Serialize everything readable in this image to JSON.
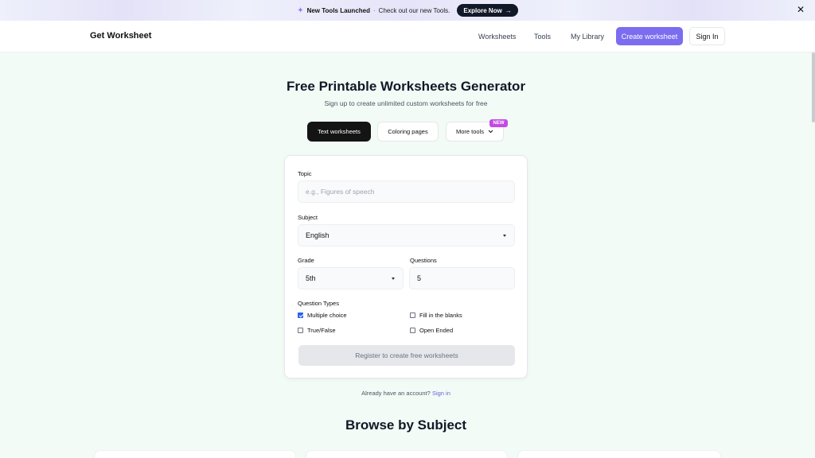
{
  "announcement": {
    "title": "New Tools Launched",
    "separator": "·",
    "message": "Check out our new Tools.",
    "cta": "Explore Now",
    "cta_arrow": "→",
    "close": "✕",
    "icon": "sparkle-icon"
  },
  "nav": {
    "brand": "Get Worksheet",
    "links": [
      "Worksheets",
      "Tools",
      "My Library"
    ],
    "create": "Create worksheet",
    "signin": "Sign In"
  },
  "hero": {
    "title": "Free Printable Worksheets Generator",
    "subtitle": "Sign up to create unlimited custom worksheets for free"
  },
  "tabs": {
    "text": "Text worksheets",
    "coloring": "Coloring pages",
    "more": "More tools",
    "badge": "NEW"
  },
  "form": {
    "topic_label": "Topic",
    "topic_placeholder": "e.g., Figures of speech",
    "subject_label": "Subject",
    "subject_value": "English",
    "grade_label": "Grade",
    "grade_value": "5th",
    "questions_label": "Questions",
    "questions_value": "5",
    "types_label": "Question Types",
    "types": [
      {
        "label": "Multiple choice",
        "checked": true
      },
      {
        "label": "Fill in the blanks",
        "checked": false
      },
      {
        "label": "True/False",
        "checked": false
      },
      {
        "label": "Open Ended",
        "checked": false
      }
    ],
    "register": "Register to create free worksheets"
  },
  "account": {
    "prompt": "Already have an account?",
    "link": "Sign in"
  },
  "browse": {
    "title": "Browse by Subject"
  },
  "colors": {
    "accent": "#7b6cf0",
    "badge": "#c24ae3",
    "page_bg": "#f2fbf5"
  }
}
